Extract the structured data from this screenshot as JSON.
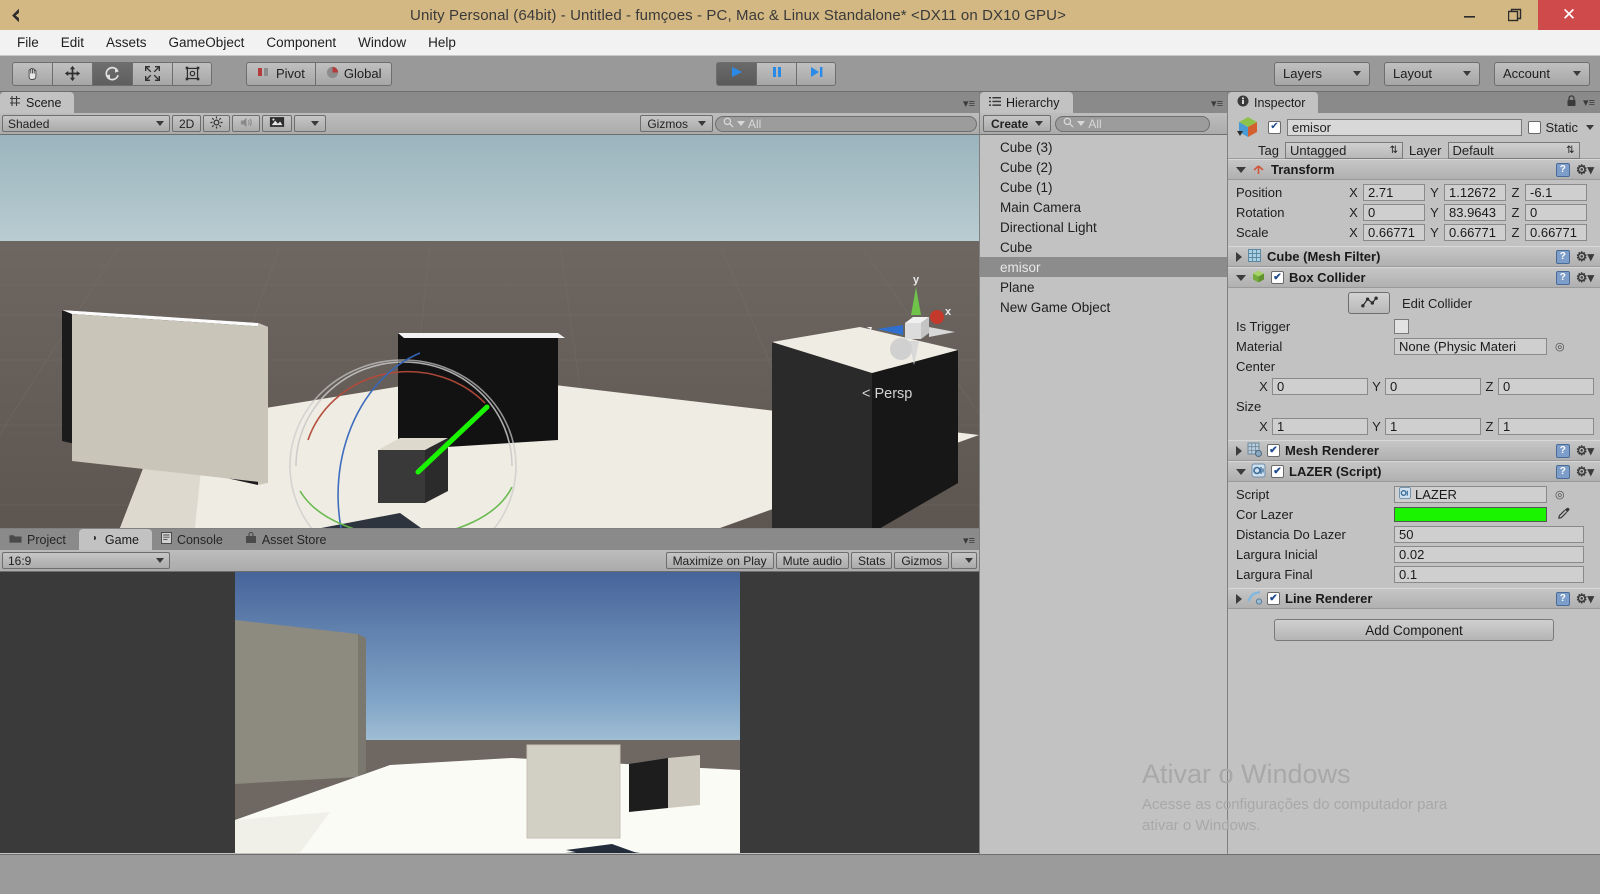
{
  "window": {
    "title": "Unity Personal (64bit) - Untitled - fumçoes - PC, Mac & Linux Standalone* <DX11 on DX10 GPU>",
    "app_icon": "unity-icon",
    "minimize": "—",
    "maximize": "❐",
    "close": "✕",
    "titlebar_color": "#d3b884",
    "close_color": "#cf4a4a"
  },
  "menubar": {
    "items": [
      {
        "label": "File"
      },
      {
        "label": "Edit"
      },
      {
        "label": "Assets"
      },
      {
        "label": "GameObject"
      },
      {
        "label": "Component"
      },
      {
        "label": "Window"
      },
      {
        "label": "Help"
      }
    ]
  },
  "toolbar": {
    "tools": [
      {
        "name": "hand-tool",
        "icon": "hand-icon",
        "active": false
      },
      {
        "name": "move-tool",
        "icon": "move-arrows-icon",
        "active": false
      },
      {
        "name": "rotate-tool",
        "icon": "rotate-icon",
        "active": true
      },
      {
        "name": "scale-tool",
        "icon": "scale-icon",
        "active": false
      },
      {
        "name": "rect-tool",
        "icon": "rect-transform-icon",
        "active": false
      }
    ],
    "pivot_label": "Pivot",
    "global_label": "Global",
    "play_label": "▶",
    "pause_label": "❚❚",
    "step_label": "▶❙",
    "layers_label": "Layers",
    "layout_label": "Layout",
    "account_label": "Account"
  },
  "scene": {
    "tab_label": "Scene",
    "tab_icon": "grid-icon",
    "shading_mode": "Shaded",
    "two_d_label": "2D",
    "light_icon": "sun-icon",
    "audio_icon": "speaker-icon",
    "fx_icon": "image-icon",
    "gizmos_label": "Gizmos",
    "search_placeholder": "All",
    "search_value": "",
    "perspective_label": "Persp",
    "axis_x": "x",
    "axis_y": "y",
    "axis_z": "z"
  },
  "hierarchy": {
    "tab_label": "Hierarchy",
    "tab_icon": "list-icon",
    "create_label": "Create",
    "search_placeholder": "All",
    "search_value": "",
    "items": [
      {
        "label": "Cube (3)",
        "selected": false
      },
      {
        "label": "Cube (2)",
        "selected": false
      },
      {
        "label": "Cube (1)",
        "selected": false
      },
      {
        "label": "Main Camera",
        "selected": false
      },
      {
        "label": "Directional Light",
        "selected": false
      },
      {
        "label": "Cube",
        "selected": false
      },
      {
        "label": "emisor",
        "selected": true
      },
      {
        "label": "Plane",
        "selected": false
      },
      {
        "label": "New Game Object",
        "selected": false
      }
    ]
  },
  "inspector": {
    "tab_label": "Inspector",
    "tab_icon": "info-icon",
    "lock_icon": "lock-icon",
    "object_enabled": true,
    "object_name": "emisor",
    "static_label": "Static",
    "static_checked": false,
    "tag_label": "Tag",
    "tag_value": "Untagged",
    "layer_label": "Layer",
    "layer_value": "Default",
    "components": [
      {
        "name": "Transform",
        "icon_color": "#d05a3c",
        "expanded": true,
        "has_checkbox": false,
        "rows": [
          {
            "label": "Position",
            "x": "2.71",
            "y": "1.12672",
            "z": "-6.1"
          },
          {
            "label": "Rotation",
            "x": "0",
            "y": "83.9643",
            "z": "0"
          },
          {
            "label": "Scale",
            "x": "0.66771",
            "y": "0.66771",
            "z": "0.66771"
          }
        ]
      },
      {
        "name": "Cube (Mesh Filter)",
        "icon_color": "#9ec8e0",
        "expanded": false,
        "has_checkbox": false
      },
      {
        "name": "Box Collider",
        "icon_color": "#7fc04a",
        "expanded": true,
        "has_checkbox": true,
        "checked": true
      },
      {
        "name": "Mesh Renderer",
        "icon_color": "#b6c8d8",
        "expanded": false,
        "has_checkbox": true,
        "checked": true
      },
      {
        "name": "LAZER (Script)",
        "icon_color": "#8fb6d8",
        "expanded": true,
        "has_checkbox": true,
        "checked": true
      },
      {
        "name": "Line Renderer",
        "icon_color": "#cfe0f0",
        "expanded": false,
        "has_checkbox": true,
        "checked": true
      }
    ],
    "box_collider": {
      "edit_collider_label": "Edit Collider",
      "edit_collider_icon": "collider-edit-icon",
      "is_trigger_label": "Is Trigger",
      "is_trigger_checked": false,
      "material_label": "Material",
      "material_value": "None (Physic Materi",
      "center_label": "Center",
      "center_x": "0",
      "center_y": "0",
      "center_z": "0",
      "size_label": "Size",
      "size_x": "1",
      "size_y": "1",
      "size_z": "1"
    },
    "lazer_script": {
      "script_label": "Script",
      "script_value": "LAZER",
      "cor_lazer_label": "Cor Lazer",
      "cor_lazer_color": "#1bf400",
      "eyedropper_icon": "eyedropper-icon",
      "distancia_label": "Distancia Do Lazer",
      "distancia_value": "50",
      "largura_inicial_label": "Largura Inicial",
      "largura_inicial_value": "0.02",
      "largura_final_label": "Largura Final",
      "largura_final_value": "0.1"
    },
    "add_component_label": "Add Component"
  },
  "bottom_panel": {
    "tabs": [
      {
        "label": "Project",
        "icon": "folder-icon",
        "active": false
      },
      {
        "label": "Game",
        "icon": "gamepad-icon",
        "active": true
      },
      {
        "label": "Console",
        "icon": "console-icon",
        "active": false
      },
      {
        "label": "Asset Store",
        "icon": "store-icon",
        "active": false
      }
    ],
    "aspect_ratio": "16:9",
    "maximize_on_play": "Maximize on Play",
    "mute_audio": "Mute audio",
    "stats": "Stats",
    "gizmos": "Gizmos"
  },
  "watermark": {
    "title": "Ativar o Windows",
    "line1": "Acesse as configurações do computador para",
    "line2": "ativar o Windows."
  }
}
